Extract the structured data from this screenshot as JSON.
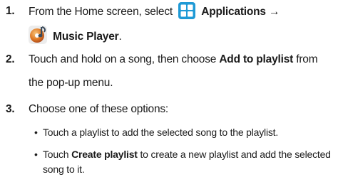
{
  "steps": [
    {
      "number": "1.",
      "parts": {
        "prefix": "From the Home screen, select",
        "apps_label": "Applications",
        "arrow": "→",
        "music_label": "Music Player",
        "suffix": "."
      },
      "icons": [
        "applications-grid-icon",
        "music-player-icon"
      ]
    },
    {
      "number": "2.",
      "parts": {
        "prefix": "Touch and hold on a song, then choose",
        "bold": "Add to playlist",
        "suffix": "from",
        "line2": "the pop-up menu."
      }
    },
    {
      "number": "3.",
      "text": "Choose one of these options:"
    }
  ],
  "bullets": [
    {
      "text": "Touch a playlist to add the selected song to the playlist."
    },
    {
      "prefix": "Touch",
      "bold": "Create playlist",
      "suffix": "to create a new playlist and add the selected song to it."
    }
  ],
  "colors": {
    "apps_icon_blue": "#1f9ad6",
    "music_icon_orange": "#e07a26",
    "text": "#1a1a1a"
  }
}
